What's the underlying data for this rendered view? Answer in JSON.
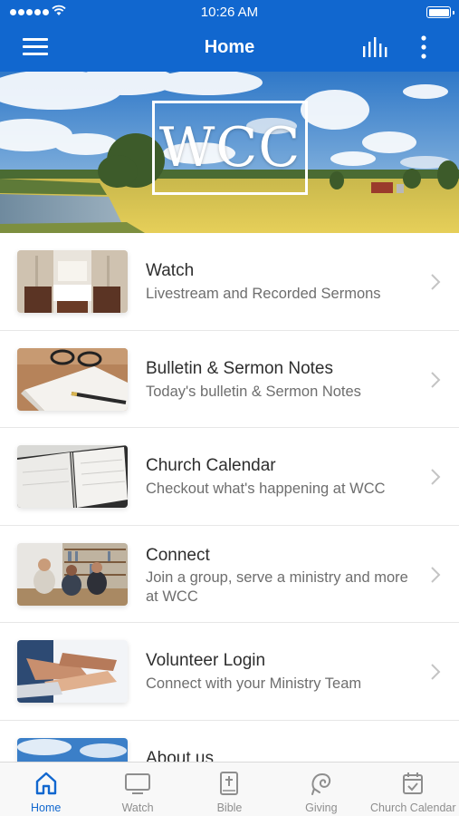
{
  "status_bar": {
    "time": "10:26 AM"
  },
  "header": {
    "title": "Home",
    "menu_icon": "hamburger-menu-icon",
    "stats_icon": "bar-chart-icon",
    "more_icon": "vertical-ellipsis-icon",
    "bg_color": "#1167cf"
  },
  "banner": {
    "logo_text": "WCC"
  },
  "list_items": [
    {
      "title": "Watch",
      "subtitle": "Livestream and Recorded Sermons",
      "thumbnail": "church-interior-photo"
    },
    {
      "title": "Bulletin & Sermon Notes",
      "subtitle": "Today's bulletin & Sermon Notes",
      "thumbnail": "notebook-with-pen-photo"
    },
    {
      "title": "Church Calendar",
      "subtitle": "Checkout what's happening at WCC",
      "thumbnail": "open-planner-photo"
    },
    {
      "title": "Connect",
      "subtitle": "Join a group, serve a ministry and more at WCC",
      "thumbnail": "group-at-bookshelf-photo"
    },
    {
      "title": "Volunteer Login",
      "subtitle": "Connect with your Ministry Team",
      "thumbnail": "stacked-hands-photo"
    },
    {
      "title": "About us",
      "subtitle": "",
      "thumbnail": "sky-photo"
    }
  ],
  "tab_bar": {
    "active_color": "#1167cf",
    "tabs": [
      {
        "label": "Home",
        "icon": "home-icon",
        "active": true
      },
      {
        "label": "Watch",
        "icon": "tv-icon",
        "active": false
      },
      {
        "label": "Bible",
        "icon": "bible-icon",
        "active": false
      },
      {
        "label": "Giving",
        "icon": "giving-icon",
        "active": false
      },
      {
        "label": "Church Calendar",
        "icon": "calendar-check-icon",
        "active": false
      }
    ]
  }
}
